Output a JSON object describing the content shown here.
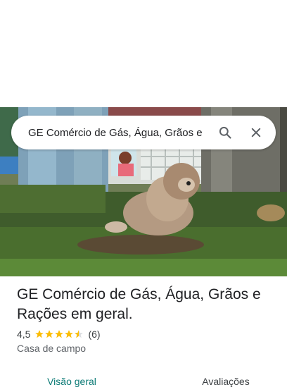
{
  "search": {
    "query": "GE Comércio de Gás, Água, Grãos e",
    "search_icon": "search-icon",
    "close_icon": "close-icon"
  },
  "place": {
    "name": "GE Comércio de Gás, Água, Grãos e Rações em geral.",
    "rating": "4,5",
    "rating_value": 4.5,
    "review_count": "(6)",
    "category": "Casa de campo"
  },
  "tabs": [
    {
      "label": "Visão geral",
      "active": true
    },
    {
      "label": "Avaliações",
      "active": false
    }
  ],
  "colors": {
    "star": "#fbbc04",
    "active_tab": "#0b7a75"
  }
}
